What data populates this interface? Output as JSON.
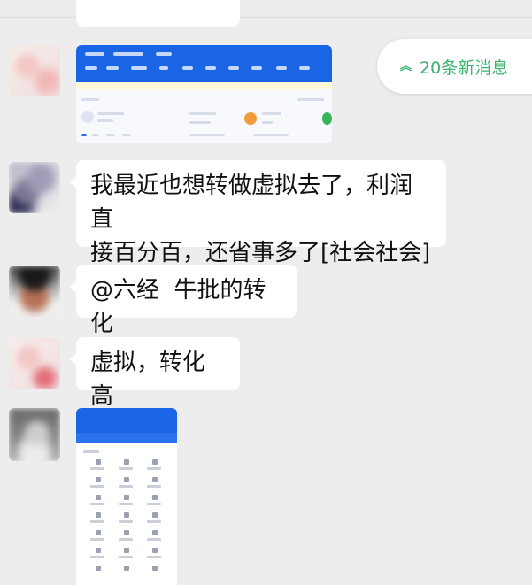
{
  "new_messages": {
    "label": "20条新消息",
    "chevron": "︽"
  },
  "messages": [
    {
      "id": "m1",
      "type": "image",
      "image_kind": "web-dashboard-screenshot"
    },
    {
      "id": "m2",
      "type": "text",
      "text": "我最近也想转做虚拟去了，利润直\n接百分百，还省事多了[社会社会]"
    },
    {
      "id": "m3",
      "type": "text",
      "text": "@六经  牛批的转化"
    },
    {
      "id": "m4",
      "type": "text",
      "text": "虚拟，转化高"
    },
    {
      "id": "m5",
      "type": "image",
      "image_kind": "mobile-app-screenshot"
    }
  ],
  "colors": {
    "background": "#ededed",
    "bubble": "#ffffff",
    "accent_green": "#3cb46e",
    "screenshot_blue": "#1a64e6"
  }
}
